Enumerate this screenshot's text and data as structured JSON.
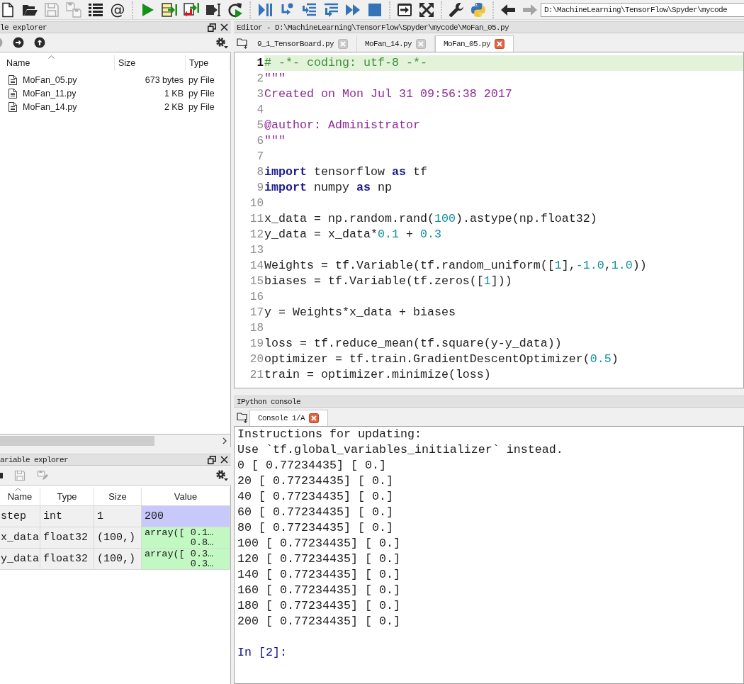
{
  "toolbar": {
    "groups": [
      {
        "buttons": [
          {
            "kind": "new",
            "disabled": false
          },
          {
            "kind": "open",
            "disabled": false
          },
          {
            "kind": "save",
            "disabled": true
          },
          {
            "kind": "saveall",
            "disabled": true
          },
          {
            "kind": "outline",
            "disabled": false
          },
          {
            "kind": "glyph",
            "text": "@",
            "disabled": false
          }
        ]
      },
      {
        "buttons": [
          {
            "kind": "run",
            "disabled": false
          },
          {
            "kind": "runcell",
            "disabled": false
          },
          {
            "kind": "runadvance",
            "disabled": false
          },
          {
            "kind": "runselection",
            "disabled": false
          },
          {
            "kind": "rerun",
            "disabled": false
          }
        ]
      },
      {
        "buttons": [
          {
            "kind": "debug",
            "disabled": false
          },
          {
            "kind": "step",
            "disabled": false
          },
          {
            "kind": "stepinto",
            "disabled": false
          },
          {
            "kind": "stepreturn",
            "disabled": false
          },
          {
            "kind": "continue",
            "disabled": false
          },
          {
            "kind": "stop",
            "disabled": false
          }
        ]
      },
      {
        "buttons": [
          {
            "kind": "maximize",
            "disabled": false
          },
          {
            "kind": "fullscreen",
            "disabled": false
          }
        ]
      },
      {
        "buttons": [
          {
            "kind": "preferences",
            "disabled": false
          },
          {
            "kind": "python",
            "disabled": false
          }
        ]
      },
      {
        "buttons": [
          {
            "kind": "back",
            "disabled": false
          },
          {
            "kind": "forward",
            "disabled": true
          }
        ]
      }
    ],
    "path": "D:\\MachineLearning\\TensorFlow\\Spyder\\mycode"
  },
  "file_explorer": {
    "title": "le explorer",
    "nav": [
      {
        "kind": "back",
        "disabled": true
      },
      {
        "kind": "forward",
        "disabled": false
      },
      {
        "kind": "up",
        "disabled": false
      }
    ],
    "columns": [
      {
        "label": "Name",
        "sorted": true
      },
      {
        "label": "Size",
        "sorted": false
      },
      {
        "label": "Type",
        "sorted": false
      }
    ],
    "rows": [
      {
        "name": "MoFan_05.py",
        "size": "673 bytes",
        "type": "py File"
      },
      {
        "name": "MoFan_11.py",
        "size": "1 KB",
        "type": "py File"
      },
      {
        "name": "MoFan_14.py",
        "size": "2 KB",
        "type": "py File"
      }
    ]
  },
  "variable_explorer": {
    "title": "ariable explorer",
    "tools": [
      {
        "kind": "import",
        "disabled": false
      },
      {
        "kind": "save",
        "disabled": true
      },
      {
        "kind": "saveas",
        "disabled": true
      }
    ],
    "columns": [
      {
        "label": "Name",
        "sorted": true
      },
      {
        "label": "Type",
        "sorted": false
      },
      {
        "label": "Size",
        "sorted": false
      },
      {
        "label": "Value",
        "sorted": false
      }
    ],
    "rows": [
      {
        "name": "step",
        "type": "int",
        "size": "1",
        "value_lines": [
          "200"
        ],
        "color": "#c8c8fa"
      },
      {
        "name": "x_data",
        "type": "float32",
        "size": "(100,)",
        "value_lines": [
          "array([ 0.1…",
          "0.8…"
        ],
        "color": "#c2f8c2"
      },
      {
        "name": "y_data",
        "type": "float32",
        "size": "(100,)",
        "value_lines": [
          "array([ 0.3…",
          "0.3…"
        ],
        "color": "#c2f8c2"
      }
    ]
  },
  "editor": {
    "title": "Editor - D:\\MachineLearning\\TensorFlow\\Spyder\\mycode\\MoFan_05.py",
    "tabs": [
      {
        "label": "9_1_TensorBoard.py",
        "selected": false
      },
      {
        "label": "MoFan_14.py",
        "selected": false
      },
      {
        "label": "MoFan_05.py",
        "selected": true
      }
    ],
    "lines": [
      {
        "number": "1",
        "current": true,
        "tokens": [
          {
            "kind": "comment",
            "text": "# -*- coding: utf-8 -*-"
          }
        ]
      },
      {
        "number": "2",
        "current": false,
        "tokens": [
          {
            "kind": "string",
            "text": "\"\"\""
          }
        ]
      },
      {
        "number": "3",
        "current": false,
        "tokens": [
          {
            "kind": "string",
            "text": "Created on Mon Jul 31 09:56:38 2017"
          }
        ]
      },
      {
        "number": "4",
        "current": false
      },
      {
        "number": "5",
        "current": false,
        "tokens": [
          {
            "kind": "string",
            "text": "@author: Administrator"
          }
        ]
      },
      {
        "number": "6",
        "current": false,
        "tokens": [
          {
            "kind": "string",
            "text": "\"\"\""
          }
        ]
      },
      {
        "number": "7",
        "current": false
      },
      {
        "number": "8",
        "current": false,
        "tokens": [
          {
            "kind": "keyword",
            "text": "import"
          },
          {
            "kind": "text",
            "text": " tensorflow "
          },
          {
            "kind": "keyword",
            "text": "as"
          },
          {
            "kind": "text",
            "text": " tf"
          }
        ]
      },
      {
        "number": "9",
        "current": false,
        "tokens": [
          {
            "kind": "keyword",
            "text": "import"
          },
          {
            "kind": "text",
            "text": " numpy "
          },
          {
            "kind": "keyword",
            "text": "as"
          },
          {
            "kind": "text",
            "text": " np"
          }
        ]
      },
      {
        "number": "10",
        "current": false
      },
      {
        "number": "11",
        "current": false,
        "tokens": [
          {
            "kind": "text",
            "text": "x_data = np.random.rand("
          },
          {
            "kind": "number",
            "text": "100"
          },
          {
            "kind": "text",
            "text": ").astype(np.float32)"
          }
        ]
      },
      {
        "number": "12",
        "current": false,
        "tokens": [
          {
            "kind": "text",
            "text": "y_data = x_data*"
          },
          {
            "kind": "number",
            "text": "0.1"
          },
          {
            "kind": "text",
            "text": " + "
          },
          {
            "kind": "number",
            "text": "0.3"
          }
        ]
      },
      {
        "number": "13",
        "current": false
      },
      {
        "number": "14",
        "current": false,
        "tokens": [
          {
            "kind": "text",
            "text": "Weights = tf.Variable(tf.random_uniform(["
          },
          {
            "kind": "number",
            "text": "1"
          },
          {
            "kind": "text",
            "text": "],"
          },
          {
            "kind": "number",
            "text": "-1.0"
          },
          {
            "kind": "text",
            "text": ","
          },
          {
            "kind": "number",
            "text": "1.0"
          },
          {
            "kind": "text",
            "text": "))"
          }
        ]
      },
      {
        "number": "15",
        "current": false,
        "tokens": [
          {
            "kind": "text",
            "text": "biases = tf.Variable(tf.zeros(["
          },
          {
            "kind": "number",
            "text": "1"
          },
          {
            "kind": "text",
            "text": "]))"
          }
        ]
      },
      {
        "number": "16",
        "current": false
      },
      {
        "number": "17",
        "current": false,
        "tokens": [
          {
            "kind": "text",
            "text": "y = Weights*x_data + biases"
          }
        ]
      },
      {
        "number": "18",
        "current": false
      },
      {
        "number": "19",
        "current": false,
        "tokens": [
          {
            "kind": "text",
            "text": "loss = tf.reduce_mean(tf.square(y-y_data))"
          }
        ]
      },
      {
        "number": "20",
        "current": false,
        "tokens": [
          {
            "kind": "text",
            "text": "optimizer = tf.train.GradientDescentOptimizer("
          },
          {
            "kind": "number",
            "text": "0.5"
          },
          {
            "kind": "text",
            "text": ")"
          }
        ]
      },
      {
        "number": "21",
        "current": false,
        "tokens": [
          {
            "kind": "text",
            "text": "train = optimizer.minimize(loss)"
          }
        ]
      }
    ]
  },
  "console": {
    "title": "IPython console",
    "tabs": [
      {
        "label": "Console 1/A",
        "selected": true
      }
    ],
    "lines": [
      {
        "kind": "output",
        "text": "Instructions for updating:"
      },
      {
        "kind": "output",
        "text": "Use `tf.global_variables_initializer` instead."
      },
      {
        "kind": "output",
        "text": "0 [ 0.77234435] [ 0.]"
      },
      {
        "kind": "output",
        "text": "20 [ 0.77234435] [ 0.]"
      },
      {
        "kind": "output",
        "text": "40 [ 0.77234435] [ 0.]"
      },
      {
        "kind": "output",
        "text": "60 [ 0.77234435] [ 0.]"
      },
      {
        "kind": "output",
        "text": "80 [ 0.77234435] [ 0.]"
      },
      {
        "kind": "output",
        "text": "100 [ 0.77234435] [ 0.]"
      },
      {
        "kind": "output",
        "text": "120 [ 0.77234435] [ 0.]"
      },
      {
        "kind": "output",
        "text": "140 [ 0.77234435] [ 0.]"
      },
      {
        "kind": "output",
        "text": "160 [ 0.77234435] [ 0.]"
      },
      {
        "kind": "output",
        "text": "180 [ 0.77234435] [ 0.]"
      },
      {
        "kind": "output",
        "text": "200 [ 0.77234435] [ 0.]"
      },
      {
        "kind": "prompt",
        "text": "In [2]:"
      }
    ]
  }
}
